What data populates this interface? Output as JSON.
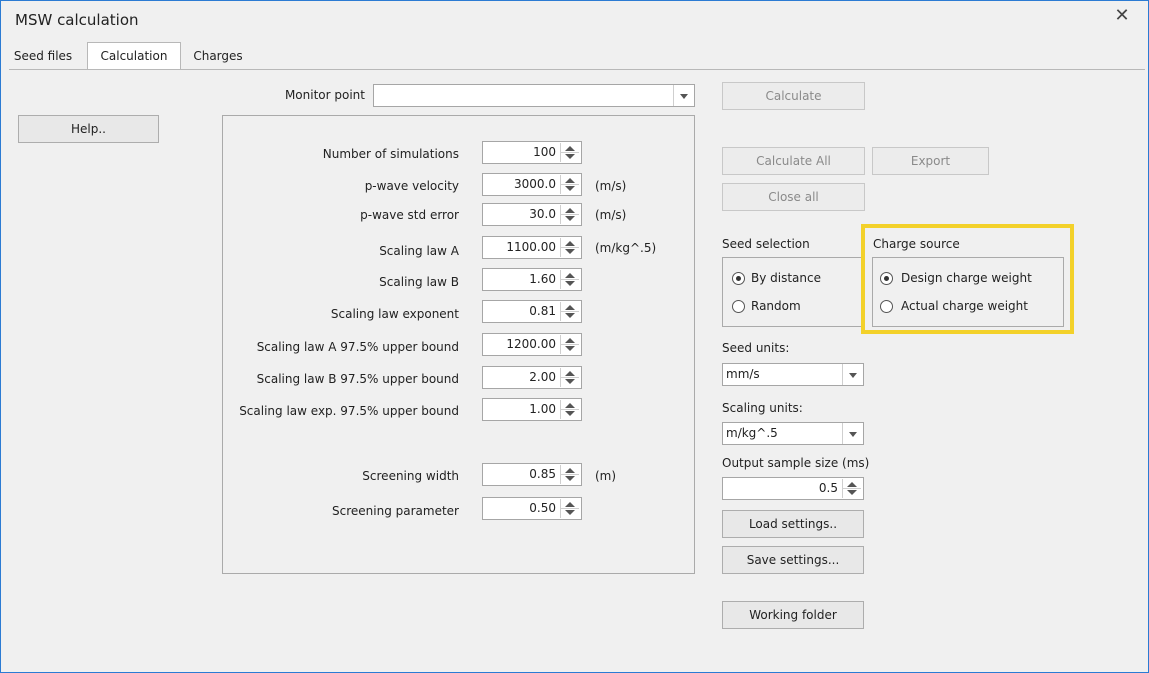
{
  "window": {
    "title": "MSW calculation",
    "close_glyph": "✕"
  },
  "tabs": [
    {
      "label": "Seed files",
      "active": false
    },
    {
      "label": "Calculation",
      "active": true
    },
    {
      "label": "Charges",
      "active": false
    }
  ],
  "monitor_point": {
    "label": "Monitor point",
    "value": ""
  },
  "help_button": "Help..",
  "params": [
    {
      "label": "Number of simulations",
      "value": "100",
      "unit": ""
    },
    {
      "label": "p-wave velocity",
      "value": "3000.0",
      "unit": "(m/s)"
    },
    {
      "label": "p-wave std error",
      "value": "30.0",
      "unit": "(m/s)"
    },
    {
      "label": "Scaling law A",
      "value": "1100.00",
      "unit": "(m/kg^.5)"
    },
    {
      "label": "Scaling law B",
      "value": "1.60",
      "unit": ""
    },
    {
      "label": "Scaling law exponent",
      "value": "0.81",
      "unit": ""
    },
    {
      "label": "Scaling law A 97.5% upper bound",
      "value": "1200.00",
      "unit": ""
    },
    {
      "label": "Scaling law B 97.5% upper bound",
      "value": "2.00",
      "unit": ""
    },
    {
      "label": "Scaling law exp. 97.5% upper bound",
      "value": "1.00",
      "unit": ""
    },
    {
      "label": "Screening width",
      "value": "0.85",
      "unit": "(m)"
    },
    {
      "label": "Screening parameter",
      "value": "0.50",
      "unit": ""
    }
  ],
  "buttons": {
    "calculate": "Calculate",
    "calculate_all": "Calculate All",
    "export": "Export",
    "close_all": "Close all",
    "load_settings": "Load settings..",
    "save_settings": "Save settings...",
    "working_folder": "Working folder"
  },
  "seed_selection": {
    "label": "Seed selection",
    "options": [
      {
        "label": "By distance",
        "selected": true
      },
      {
        "label": "Random",
        "selected": false
      }
    ]
  },
  "charge_source": {
    "label": "Charge source",
    "options": [
      {
        "label": "Design charge weight",
        "selected": true
      },
      {
        "label": "Actual charge weight",
        "selected": false
      }
    ]
  },
  "seed_units": {
    "label": "Seed units:",
    "value": "mm/s"
  },
  "scaling_units": {
    "label": "Scaling units:",
    "value": "m/kg^.5"
  },
  "output_sample_size": {
    "label": "Output sample size (ms)",
    "value": "0.5"
  },
  "colors": {
    "highlight": "#f3d12a",
    "window_border": "#2b7bd3"
  }
}
